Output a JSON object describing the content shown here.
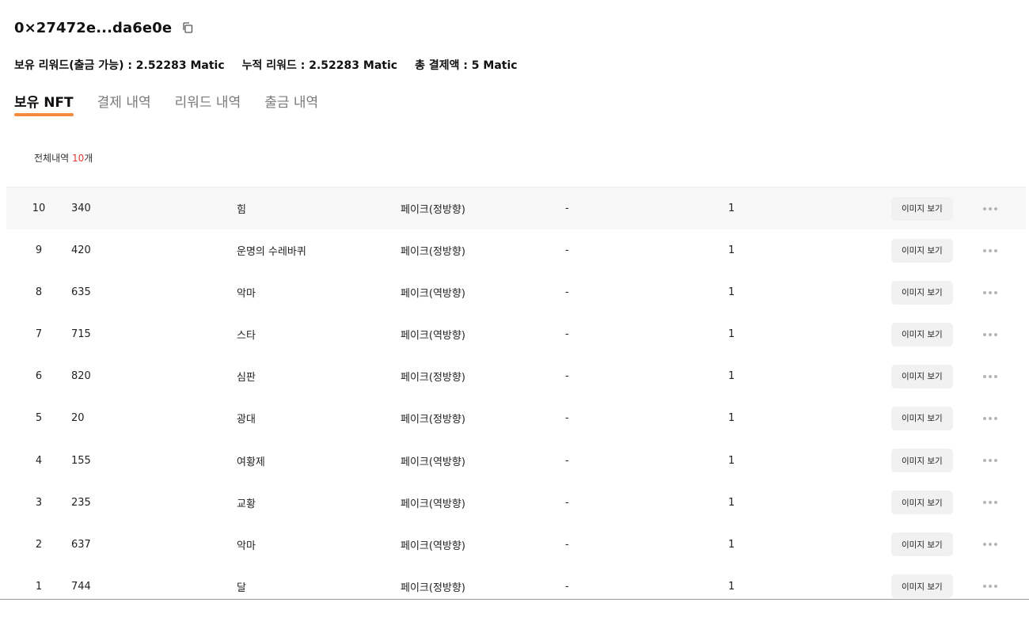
{
  "header": {
    "address": "0×27472e...da6e0e"
  },
  "summary": {
    "held_reward": "보유 리워드(출금 가능) : 2.52283 Matic",
    "cumulative_reward": "누적 리워드 : 2.52283 Matic",
    "total_payment": "총 결제액 : 5 Matic"
  },
  "tabs": [
    {
      "label": "보유 NFT",
      "active": true
    },
    {
      "label": "결제 내역",
      "active": false
    },
    {
      "label": "리워드 내역",
      "active": false
    },
    {
      "label": "출금 내역",
      "active": false
    }
  ],
  "total": {
    "prefix": "전체내역 ",
    "count": "10",
    "suffix": "개"
  },
  "table": {
    "view_image_label": "이미지 보기",
    "rows": [
      {
        "idx": "10",
        "id": "340",
        "name": "힘",
        "type": "페이크(정방향)",
        "extra": "-",
        "qty": "1"
      },
      {
        "idx": "9",
        "id": "420",
        "name": "운명의 수레바퀴",
        "type": "페이크(정방향)",
        "extra": "-",
        "qty": "1"
      },
      {
        "idx": "8",
        "id": "635",
        "name": "악마",
        "type": "페이크(역방향)",
        "extra": "-",
        "qty": "1"
      },
      {
        "idx": "7",
        "id": "715",
        "name": "스타",
        "type": "페이크(역방향)",
        "extra": "-",
        "qty": "1"
      },
      {
        "idx": "6",
        "id": "820",
        "name": "심판",
        "type": "페이크(정방향)",
        "extra": "-",
        "qty": "1"
      },
      {
        "idx": "5",
        "id": "20",
        "name": "광대",
        "type": "페이크(정방향)",
        "extra": "-",
        "qty": "1"
      },
      {
        "idx": "4",
        "id": "155",
        "name": "여황제",
        "type": "페이크(역방향)",
        "extra": "-",
        "qty": "1"
      },
      {
        "idx": "3",
        "id": "235",
        "name": "교황",
        "type": "페이크(역방향)",
        "extra": "-",
        "qty": "1"
      },
      {
        "idx": "2",
        "id": "637",
        "name": "악마",
        "type": "페이크(역방향)",
        "extra": "-",
        "qty": "1"
      },
      {
        "idx": "1",
        "id": "744",
        "name": "달",
        "type": "페이크(정방향)",
        "extra": "-",
        "qty": "1"
      }
    ]
  },
  "colors": {
    "accent_underline": "#f58a3f",
    "count_highlight": "#e53935"
  },
  "icons": {
    "copy": "copy-icon",
    "more": "more-horizontal-icon"
  }
}
